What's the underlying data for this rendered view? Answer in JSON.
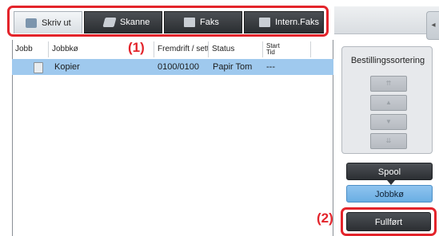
{
  "tabs": [
    {
      "label": "Skriv ut",
      "icon": "print-icon",
      "active": true
    },
    {
      "label": "Skanne",
      "icon": "scan-icon",
      "active": false
    },
    {
      "label": "Faks",
      "icon": "fax-icon",
      "active": false
    },
    {
      "label": "Intern.Faks",
      "icon": "internet-fax-icon",
      "active": false
    }
  ],
  "callouts": {
    "one": "(1)",
    "two": "(2)"
  },
  "table": {
    "headers": [
      "Jobb",
      "Jobbkø",
      "Fremdrift / sett",
      "Status",
      "Start\nTid"
    ],
    "rows": [
      {
        "job_icon": "copy-doc-icon",
        "queue": "Kopier",
        "progress": "0100/0100",
        "status": "Papir Tom",
        "start": "---"
      }
    ]
  },
  "sort": {
    "title": "Bestillingssortering",
    "buttons": [
      "top",
      "up",
      "down",
      "bottom"
    ]
  },
  "buttons": {
    "spool": "Spool",
    "jobbko": "Jobbkø",
    "fullfort": "Fullført"
  },
  "colors": {
    "accent_red": "#e3242b",
    "selected_row": "#9fc9ee",
    "active_blue": "#7cb8e8"
  }
}
